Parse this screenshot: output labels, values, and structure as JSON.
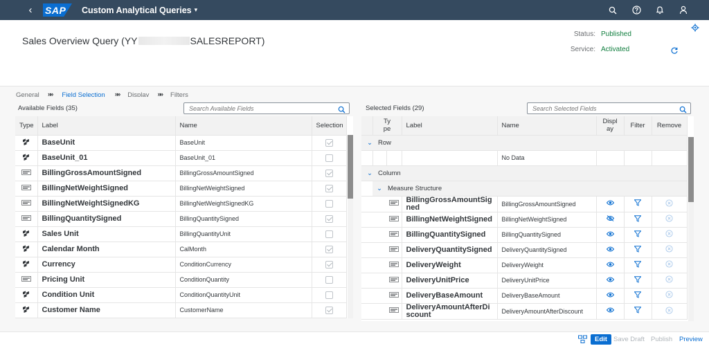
{
  "shell": {
    "back_label": "‹",
    "logo_text": "SAP",
    "app_title": "Custom Analytical Queries",
    "app_title_caret": "▾"
  },
  "header": {
    "title_prefix": "Sales Overview Query (YY",
    "title_suffix": "SALESREPORT)",
    "status_label": "Status:",
    "status_value": "Published",
    "service_label": "Service:",
    "service_value": "Activated"
  },
  "steps": [
    "General",
    "Field Selection",
    "Display",
    "Filters"
  ],
  "steps_separator": "»»",
  "available": {
    "title": "Available Fields (35)",
    "search_placeholder": "Search Available Fields",
    "columns": {
      "type": "Type",
      "label": "Label",
      "name": "Name",
      "selection": "Selection"
    },
    "rows": [
      {
        "type": "dimension",
        "label": "BaseUnit",
        "name": "BaseUnit",
        "selected": true
      },
      {
        "type": "dimension",
        "label": "BaseUnit_01",
        "name": "BaseUnit_01",
        "selected": false
      },
      {
        "type": "measure",
        "label": "BillingGrossAmountSigned",
        "name": "BillingGrossAmountSigned",
        "selected": true
      },
      {
        "type": "measure",
        "label": "BillingNetWeightSigned",
        "name": "BillingNetWeightSigned",
        "selected": true
      },
      {
        "type": "measure",
        "label": "BillingNetWeightSignedKG",
        "name": "BillingNetWeightSignedKG",
        "selected": false
      },
      {
        "type": "measure",
        "label": "BillingQuantitySigned",
        "name": "BillingQuantitySigned",
        "selected": true
      },
      {
        "type": "dimension",
        "label": "Sales Unit",
        "name": "BillingQuantityUnit",
        "selected": false
      },
      {
        "type": "dimension",
        "label": "Calendar Month",
        "name": "CalMonth",
        "selected": true
      },
      {
        "type": "dimension",
        "label": "Currency",
        "name": "ConditionCurrency",
        "selected": true
      },
      {
        "type": "measure",
        "label": "Pricing Unit",
        "name": "ConditionQuantity",
        "selected": false
      },
      {
        "type": "dimension",
        "label": "Condition Unit",
        "name": "ConditionQuantityUnit",
        "selected": false
      },
      {
        "type": "dimension",
        "label": "Customer Name",
        "name": "CustomerName",
        "selected": true
      }
    ]
  },
  "selected": {
    "title": "Selected Fields (29)",
    "search_placeholder": "Search Selected Fields",
    "columns": {
      "type": "Type",
      "label": "Label",
      "name": "Name",
      "display": "Display",
      "filter": "Filter",
      "remove": "Remove"
    },
    "row_group": "Row",
    "no_data": "No Data",
    "column_group": "Column",
    "measure_structure": "Measure Structure",
    "rows": [
      {
        "label": "BillingGrossAmountSigned",
        "name": "BillingGrossAmountSigned",
        "visible": true
      },
      {
        "label": "BillingNetWeightSigned",
        "name": "BillingNetWeightSigned",
        "visible": false
      },
      {
        "label": "BillingQuantitySigned",
        "name": "BillingQuantitySigned",
        "visible": true
      },
      {
        "label": "DeliveryQuantitySigned",
        "name": "DeliveryQuantitySigned",
        "visible": true
      },
      {
        "label": "DeliveryWeight",
        "name": "DeliveryWeight",
        "visible": true
      },
      {
        "label": "DeliveryUnitPrice",
        "name": "DeliveryUnitPrice",
        "visible": true
      },
      {
        "label": "DeliveryBaseAmount",
        "name": "DeliveryBaseAmount",
        "visible": true
      },
      {
        "label": "DeliveryAmountAfterDiscount",
        "name": "DeliveryAmountAfterDiscount",
        "visible": true
      }
    ]
  },
  "footer": {
    "edit": "Edit",
    "save_draft": "Save Draft",
    "publish": "Publish",
    "preview": "Preview"
  },
  "colors": {
    "shell": "#354a5f",
    "accent": "#0a6ed1",
    "positive": "#107e3e"
  }
}
